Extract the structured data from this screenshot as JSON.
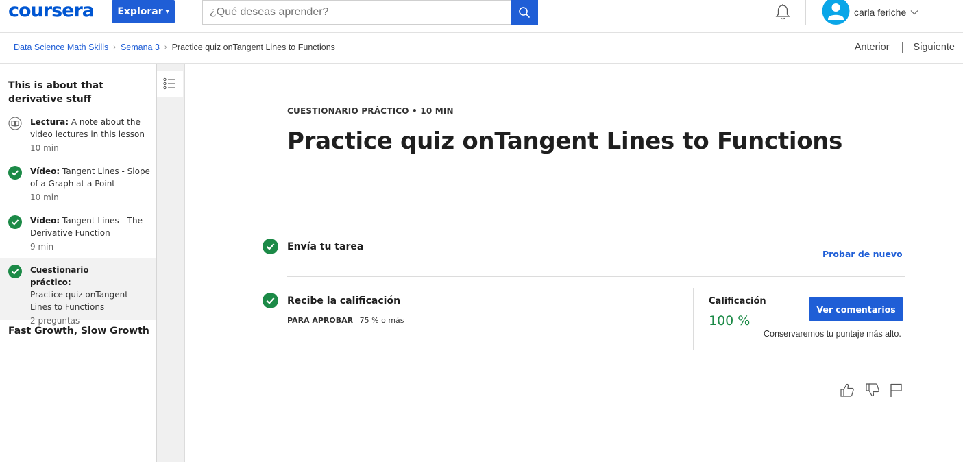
{
  "header": {
    "logo_text": "coursera",
    "explore_label": "Explorar",
    "search_placeholder": "¿Qué deseas aprender?",
    "user_name": "carla feriche",
    "brand_color": "#0056d2"
  },
  "breadcrumb": {
    "items": [
      "Data Science Math Skills",
      "Semana 3"
    ],
    "current": "Practice quiz onTangent Lines to Functions"
  },
  "nav": {
    "prev_label": "Anterior",
    "next_label": "Siguiente"
  },
  "sidebar": {
    "section1_title": "This is about that derivative stuff",
    "items": [
      {
        "kind": "Lectura:",
        "title": "A note about the video lectures in this lesson",
        "duration": "10 min",
        "icon": "book-icon",
        "completed": false
      },
      {
        "kind": "Vídeo:",
        "title": "Tangent Lines - Slope of a Graph at a Point",
        "duration": "10 min",
        "icon": "check-icon",
        "completed": true
      },
      {
        "kind": "Vídeo:",
        "title": "Tangent Lines - The Derivative Function",
        "duration": "9 min",
        "icon": "check-icon",
        "completed": true
      },
      {
        "kind": "Cuestionario práctico:",
        "title": "Practice quiz onTangent Lines to Functions",
        "duration": "2 preguntas",
        "icon": "check-icon",
        "completed": true
      }
    ],
    "section2_title": "Fast Growth, Slow Growth"
  },
  "main": {
    "eyebrow": "CUESTIONARIO PRÁCTICO • 10 MIN",
    "title": "Practice quiz onTangent Lines to Functions",
    "step1": {
      "title": "Envía tu tarea",
      "action": "Probar de nuevo"
    },
    "step2": {
      "title": "Recibe la calificación",
      "pass_label": "PARA APROBAR",
      "pass_value": "75 % o más",
      "grade_label": "Calificación",
      "grade_value": "100 %",
      "feedback_button": "Ver comentarios",
      "note": "Conservaremos tu puntaje más alto."
    }
  },
  "colors": {
    "accent": "#1f5ed6",
    "success": "#1c8a47"
  }
}
